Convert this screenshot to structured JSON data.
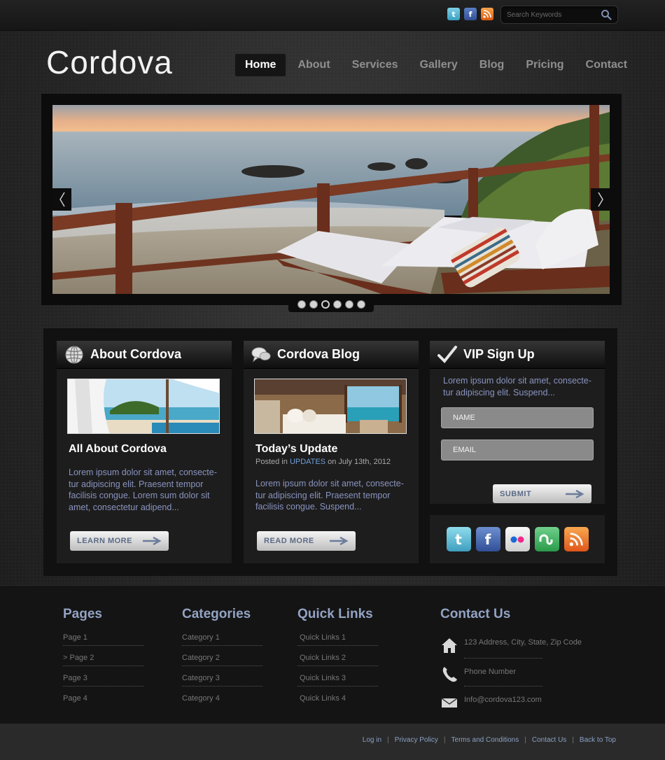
{
  "header": {
    "logo": "Cordova",
    "search": {
      "placeholder": "Search Keywords"
    },
    "nav": [
      "Home",
      "About",
      "Services",
      "Gallery",
      "Blog",
      "Pricing",
      "Contact"
    ]
  },
  "slider": {
    "dots": 6,
    "active_dot": 3
  },
  "about": {
    "heading": "About Cordova",
    "post_title": "All About Cordova",
    "body": "Lorem ipsum dolor sit amet, consecte-tur adipiscing elit. Praesent tempor facilisis congue. Lorem sum dolor sit amet, consectetur adipend...",
    "button": "LEARN MORE"
  },
  "blog": {
    "heading": "Cordova Blog",
    "post_title": "Today’s Update",
    "posted_prefix": "Posted in",
    "category": "UPDATES",
    "posted_date": "on July 13th, 2012",
    "body": "Lorem ipsum dolor sit amet, consecte-tur adipiscing elit. Praesent tempor facilisis congue. Suspend...",
    "button": "READ MORE"
  },
  "vip": {
    "heading": "VIP Sign Up",
    "text": "Lorem ipsum dolor sit amet, consecte-tur adipiscing elit. Suspend...",
    "name_placeholder": "NAME",
    "email_placeholder": "EMAIL",
    "button": "SUBMIT"
  },
  "social_icons": [
    "twitter-icon",
    "facebook-icon",
    "flickr-icon",
    "stumbleupon-icon",
    "rss-icon"
  ],
  "footer": {
    "pages": {
      "title": "Pages",
      "links": [
        "Page 1",
        ">  Page 2",
        "Page 3",
        "Page 4"
      ]
    },
    "categories": {
      "title": "Categories",
      "links": [
        "Category  1",
        "Category  2",
        "Category  3",
        "Category  4"
      ]
    },
    "quick_links": {
      "title": "Quick Links",
      "links": [
        "Quick Links 1",
        "Quick Links 2",
        "Quick Links 3",
        "Quick Links 4"
      ]
    },
    "contact": {
      "title": "Contact Us",
      "address": "123 Address, City, State, Zip Code",
      "phone": "Phone Number",
      "email": "Info@cordova123.com"
    }
  },
  "bottom_links": [
    "Log in",
    "Privacy Policy",
    "Terms and Conditions",
    "Contact Us",
    "Back to Top"
  ]
}
